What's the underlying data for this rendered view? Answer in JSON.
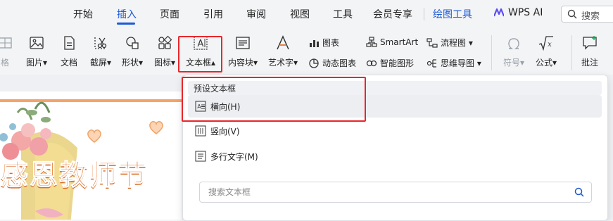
{
  "menubar": {
    "items": [
      {
        "label": "开始"
      },
      {
        "label": "插入"
      },
      {
        "label": "页面"
      },
      {
        "label": "引用"
      },
      {
        "label": "审阅"
      },
      {
        "label": "视图"
      },
      {
        "label": "工具"
      },
      {
        "label": "会员专享"
      },
      {
        "label": "绘图工具"
      }
    ],
    "active": "插入",
    "wps_ai": "WPS AI",
    "search_placeholder": "搜索"
  },
  "ribbon": {
    "table_partial": "格",
    "picture": "图片",
    "document": "文档",
    "screenshot": "截屏",
    "shape": "形状",
    "icon": "图标",
    "textbox": "文本框",
    "content_block": "内容块",
    "wordart": "艺术字",
    "chart": "图表",
    "dynamic_chart": "动态图表",
    "smartart": "SmartArt",
    "smart_graphic": "智能图形",
    "flowchart": "流程图",
    "mindmap": "思维导图",
    "symbol": "符号",
    "formula": "公式",
    "comment": "批注"
  },
  "slide": {
    "title": "感恩教师节"
  },
  "dropdown": {
    "header": "预设文本框",
    "items": [
      {
        "label": "横向(H)"
      },
      {
        "label": "竖向(V)"
      },
      {
        "label": "多行文字(M)"
      }
    ],
    "search_placeholder": "搜索文本框"
  },
  "colors": {
    "accent": "#1a5ad7",
    "highlight_border": "#e8262b",
    "title_orange": "#e9813c"
  }
}
